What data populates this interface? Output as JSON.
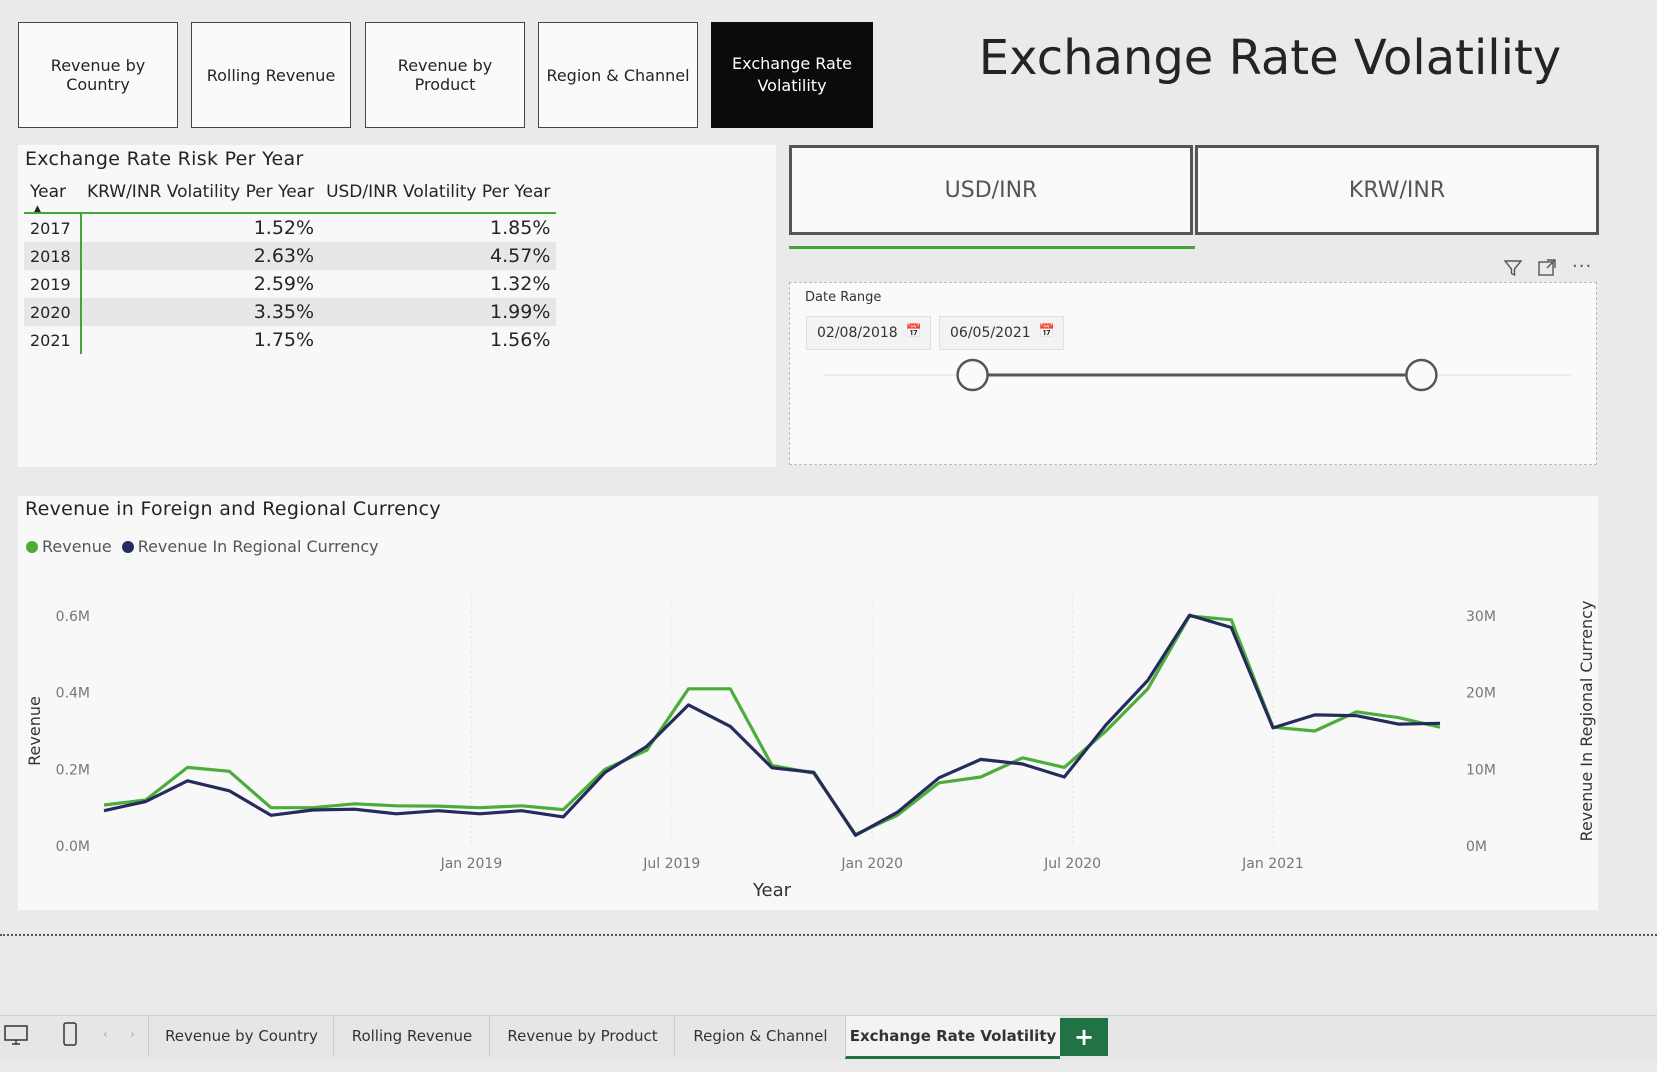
{
  "nav_buttons": [
    {
      "label": "Revenue by Country"
    },
    {
      "label": "Rolling Revenue"
    },
    {
      "label": "Revenue by Product"
    },
    {
      "label": "Region & Channel"
    },
    {
      "label": "Exchange Rate Volatility"
    }
  ],
  "page_title": "Exchange Rate Volatility",
  "risk_table": {
    "title": "Exchange Rate Risk Per Year",
    "columns": [
      "Year",
      "KRW/INR Volatility Per Year",
      "USD/INR Volatility Per Year"
    ],
    "rows": [
      {
        "year": "2017",
        "krw": "1.52%",
        "usd": "1.85%"
      },
      {
        "year": "2018",
        "krw": "2.63%",
        "usd": "4.57%"
      },
      {
        "year": "2019",
        "krw": "2.59%",
        "usd": "1.32%"
      },
      {
        "year": "2020",
        "krw": "3.35%",
        "usd": "1.99%"
      },
      {
        "year": "2021",
        "krw": "1.75%",
        "usd": "1.56%"
      }
    ]
  },
  "currency_toggles": [
    {
      "label": "USD/INR",
      "selected": true
    },
    {
      "label": "KRW/INR",
      "selected": false
    }
  ],
  "date_slicer": {
    "label": "Date Range",
    "start": "02/08/2018",
    "end": "06/05/2021",
    "range_selected_fraction": [
      0.2,
      0.8
    ]
  },
  "visual_header_icons": [
    "filter-icon",
    "focus-mode-icon",
    "more-options-icon"
  ],
  "chart_data": {
    "type": "line",
    "title": "Revenue in Foreign and Regional Currency",
    "xlabel": "Year",
    "ylabel": "Revenue",
    "y2label": "Revenue In Regional Currency",
    "x_tick_labels": [
      "Jan 2019",
      "Jul 2019",
      "Jan 2020",
      "Jul 2020",
      "Jan 2021"
    ],
    "y_tick_labels": [
      "0.0M",
      "0.2M",
      "0.4M",
      "0.6M"
    ],
    "y2_tick_labels": [
      "0M",
      "10M",
      "20M",
      "30M"
    ],
    "ylim": [
      0,
      0.6
    ],
    "y2lim": [
      0,
      30
    ],
    "x": [
      "2018-02",
      "2018-04",
      "2018-06",
      "2018-08",
      "2018-10",
      "2018-12",
      "2019-02",
      "2019-04",
      "2019-06",
      "2019-08",
      "2019-10",
      "2019-12",
      "2020-02",
      "2020-04",
      "2020-06",
      "2020-08",
      "2020-10",
      "2020-12",
      "2021-02",
      "2021-04",
      "2021-05"
    ],
    "legend_position": "top-left",
    "series": [
      {
        "name": "Revenue",
        "color": "#4cad3b",
        "axis": "left",
        "values": [
          0.107,
          0.12,
          0.205,
          0.195,
          0.1,
          0.1,
          0.11,
          0.105,
          0.104,
          0.1,
          0.105,
          0.095,
          0.2,
          0.25,
          0.41,
          0.41,
          0.21,
          0.19,
          0.03,
          0.08,
          0.165,
          0.18,
          0.23,
          0.205,
          0.3,
          0.41,
          0.6,
          0.59,
          0.31,
          0.3,
          0.35,
          0.335,
          0.31
        ]
      },
      {
        "name": "Revenue In Regional Currency",
        "color": "#252b5c",
        "axis": "right",
        "values": [
          4.6,
          5.8,
          8.5,
          7.2,
          4.0,
          4.7,
          4.8,
          4.2,
          4.6,
          4.2,
          4.6,
          3.8,
          9.6,
          13.0,
          18.4,
          15.6,
          10.2,
          9.6,
          1.4,
          4.4,
          8.9,
          11.3,
          10.7,
          9.0,
          15.8,
          21.6,
          30.1,
          28.5,
          15.4,
          17.1,
          17.0,
          15.9,
          16.0
        ]
      }
    ]
  },
  "report_tabs": [
    {
      "label": "Revenue by Country"
    },
    {
      "label": "Rolling Revenue"
    },
    {
      "label": "Revenue by Product"
    },
    {
      "label": "Region & Channel"
    },
    {
      "label": "Exchange Rate Volatility",
      "active": true
    }
  ],
  "add_page_label": "+",
  "accent_color": "#217346"
}
